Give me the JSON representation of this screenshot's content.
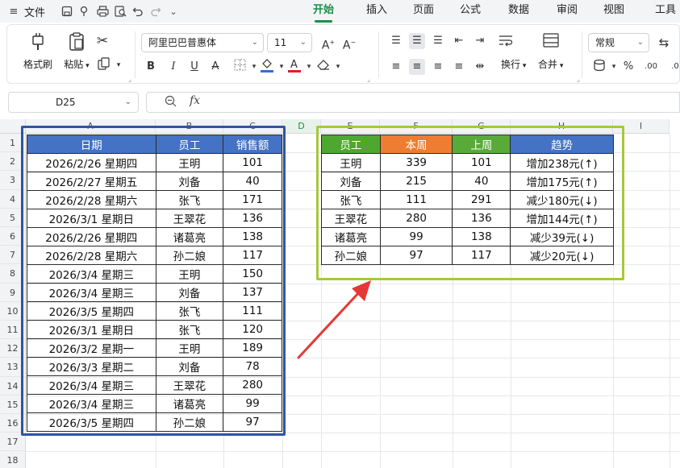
{
  "menubar": {
    "menu_icon": "≡",
    "file_label": "文件",
    "tabs": [
      {
        "label": "开始",
        "active": true
      },
      {
        "label": "插入",
        "active": false
      },
      {
        "label": "页面",
        "active": false
      },
      {
        "label": "公式",
        "active": false
      },
      {
        "label": "数据",
        "active": false
      },
      {
        "label": "审阅",
        "active": false
      },
      {
        "label": "视图",
        "active": false
      },
      {
        "label": "工具",
        "active": false
      }
    ]
  },
  "ribbon": {
    "format_painter": "格式刷",
    "paste": "粘贴",
    "font_name": "阿里巴巴普惠体",
    "font_size": "11",
    "wrap": "换行",
    "merge": "合并",
    "number_format": "常规",
    "font_color": "#e02020",
    "fill_color": "#2f6fd6"
  },
  "formula_bar": {
    "cell_ref": "D25",
    "fx_label": "fx",
    "content": ""
  },
  "sheet": {
    "columns": [
      "A",
      "B",
      "C",
      "D",
      "E",
      "F",
      "G",
      "H",
      "I"
    ],
    "rows": [
      "1",
      "2",
      "3",
      "4",
      "5",
      "6",
      "7",
      "8",
      "9",
      "10",
      "11",
      "12",
      "13",
      "14",
      "15",
      "16",
      "17",
      "18"
    ],
    "left_table": {
      "headers": [
        "日期",
        "员工",
        "销售额"
      ],
      "rows": [
        [
          "2026/2/26 星期四",
          "王明",
          "101"
        ],
        [
          "2026/2/27 星期五",
          "刘备",
          "40"
        ],
        [
          "2026/2/28 星期六",
          "张飞",
          "171"
        ],
        [
          "2026/3/1 星期日",
          "王翠花",
          "136"
        ],
        [
          "2026/2/26 星期四",
          "诸葛亮",
          "138"
        ],
        [
          "2026/2/28 星期六",
          "孙二娘",
          "117"
        ],
        [
          "2026/3/4 星期三",
          "王明",
          "150"
        ],
        [
          "2026/3/4 星期三",
          "刘备",
          "137"
        ],
        [
          "2026/3/5 星期四",
          "张飞",
          "111"
        ],
        [
          "2026/3/1 星期日",
          "张飞",
          "120"
        ],
        [
          "2026/3/2 星期一",
          "王明",
          "189"
        ],
        [
          "2026/3/3 星期二",
          "刘备",
          "78"
        ],
        [
          "2026/3/4 星期三",
          "王翠花",
          "280"
        ],
        [
          "2026/3/4 星期三",
          "诸葛亮",
          "99"
        ],
        [
          "2026/3/5 星期四",
          "孙二娘",
          "97"
        ]
      ]
    },
    "right_table": {
      "headers": [
        "员工",
        "本周",
        "上周",
        "趋势"
      ],
      "header_colors": [
        "#4ea72e",
        "#ed7d31",
        "#5aaa3a",
        "#4472c4"
      ],
      "rows": [
        [
          "王明",
          "339",
          "101",
          "增加238元(↑)"
        ],
        [
          "刘备",
          "215",
          "40",
          "增加175元(↑)"
        ],
        [
          "张飞",
          "111",
          "291",
          "减少180元(↓)"
        ],
        [
          "王翠花",
          "280",
          "136",
          "增加144元(↑)"
        ],
        [
          "诸葛亮",
          "99",
          "138",
          "减少39元(↓)"
        ],
        [
          "孙二娘",
          "97",
          "117",
          "减少20元(↓)"
        ]
      ]
    },
    "annotation_colors": {
      "left_frame": "#2f55a4",
      "right_frame": "#a6c83a",
      "arrow": "#e53935"
    }
  }
}
